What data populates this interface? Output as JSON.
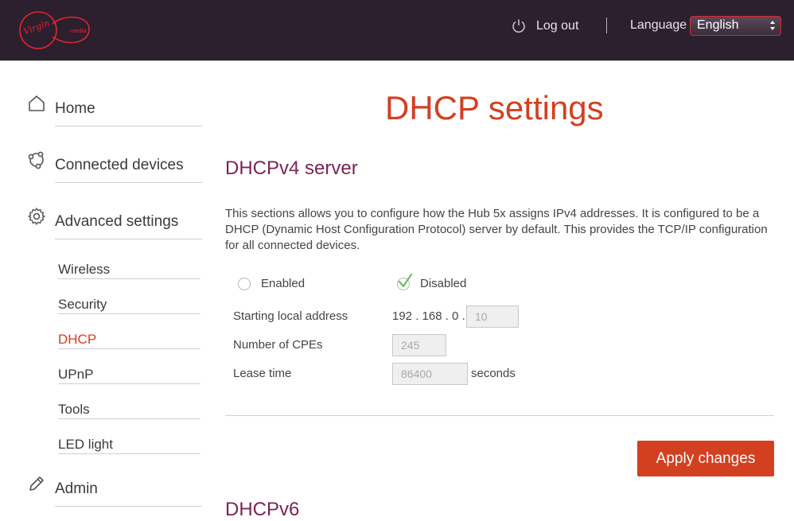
{
  "brand": {
    "logo_line1": "Virgin",
    "logo_line2": "media",
    "accent": "#d3401f",
    "header_bg": "#2c1f2e"
  },
  "header": {
    "logout_label": "Log out",
    "language_label": "Language",
    "language_selected": "English"
  },
  "sidebar": {
    "main": [
      {
        "label": "Home",
        "icon": "home-icon"
      },
      {
        "label": "Connected devices",
        "icon": "connected-devices-icon"
      },
      {
        "label": "Advanced settings",
        "icon": "gear-icon"
      },
      {
        "label": "Admin",
        "icon": "pencil-icon"
      }
    ],
    "sub": [
      "Wireless",
      "Security",
      "DHCP",
      "UPnP",
      "Tools",
      "LED light"
    ],
    "active_sub": "DHCP"
  },
  "main": {
    "title": "DHCP settings",
    "section_title": "DHCPv4 server",
    "description": "This sections allows you to configure how the Hub 5x assigns IPv4 addresses. It is configured to be a DHCP (Dynamic Host Configuration Protocol) server by default. This provides the TCP/IP configuration for all connected devices.",
    "radio_enabled": "Enabled",
    "radio_disabled": "Disabled",
    "fields": {
      "start_label": "Starting local address",
      "ip_prefix": "192 . 168 . 0 .",
      "ip_last": "10",
      "cpes_label": "Number of CPEs",
      "cpes_value": "245",
      "lease_label": "Lease time",
      "lease_value": "86400",
      "lease_unit": "seconds"
    },
    "apply_label": "Apply changes",
    "next_section_title": "DHCPv6"
  }
}
